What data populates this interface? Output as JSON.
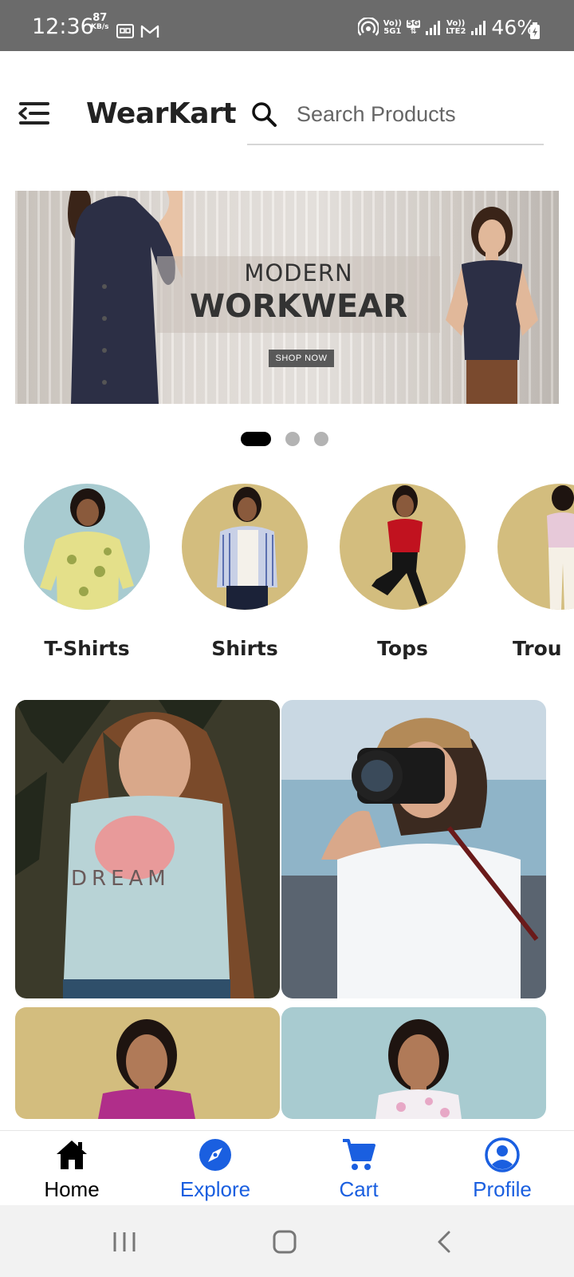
{
  "status_bar": {
    "time": "12:36",
    "net_speed_value": "87",
    "net_speed_unit": "KB/s",
    "volte1": "Vo))",
    "volte1_sub": "5G1",
    "fiveg": "5G",
    "volte2": "Vo))",
    "volte2_sub": "LTE2",
    "battery": "46%"
  },
  "header": {
    "brand": "WearKart",
    "search_placeholder": "Search Products"
  },
  "banner": {
    "line1": "MODERN",
    "line2": "WORKWEAR",
    "cta": "SHOP NOW",
    "slide_count": 3,
    "active_slide": 1
  },
  "categories": [
    {
      "label": "T-Shirts",
      "bg": "#a8cbd0"
    },
    {
      "label": "Shirts",
      "bg": "#d3bd7e"
    },
    {
      "label": "Tops",
      "bg": "#d3bd7e"
    },
    {
      "label": "Trou",
      "bg": "#d3bd7e"
    }
  ],
  "bottom_nav": {
    "items": [
      {
        "label": "Home",
        "icon": "home-icon",
        "active": true
      },
      {
        "label": "Explore",
        "icon": "compass-icon",
        "active": false
      },
      {
        "label": "Cart",
        "icon": "cart-icon",
        "active": false
      },
      {
        "label": "Profile",
        "icon": "profile-icon",
        "active": false
      }
    ],
    "active_color": "#000000",
    "inactive_color": "#1a5fe0"
  }
}
